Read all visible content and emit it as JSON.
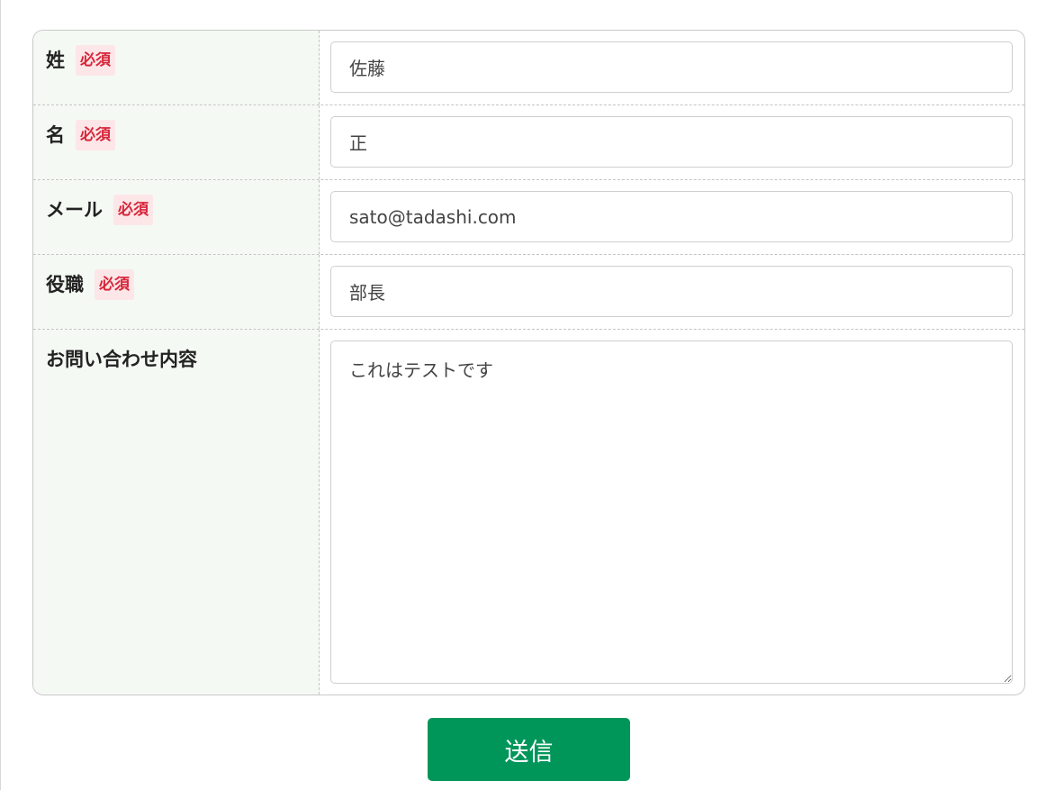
{
  "form": {
    "fields": [
      {
        "label": "姓",
        "badge": "必須",
        "value": "佐藤"
      },
      {
        "label": "名",
        "badge": "必須",
        "value": "正"
      },
      {
        "label": "メール",
        "badge": "必須",
        "value": "sato@tadashi.com"
      },
      {
        "label": "役職",
        "badge": "必須",
        "value": "部長"
      }
    ],
    "message": {
      "label": "お問い合わせ内容",
      "value": "これはテストです"
    },
    "submit_label": "送信"
  },
  "colors": {
    "label_background": "#f4f9f3",
    "required_badge_background": "#fde6e8",
    "required_badge_text": "#d6263a",
    "submit_background": "#00965a"
  }
}
